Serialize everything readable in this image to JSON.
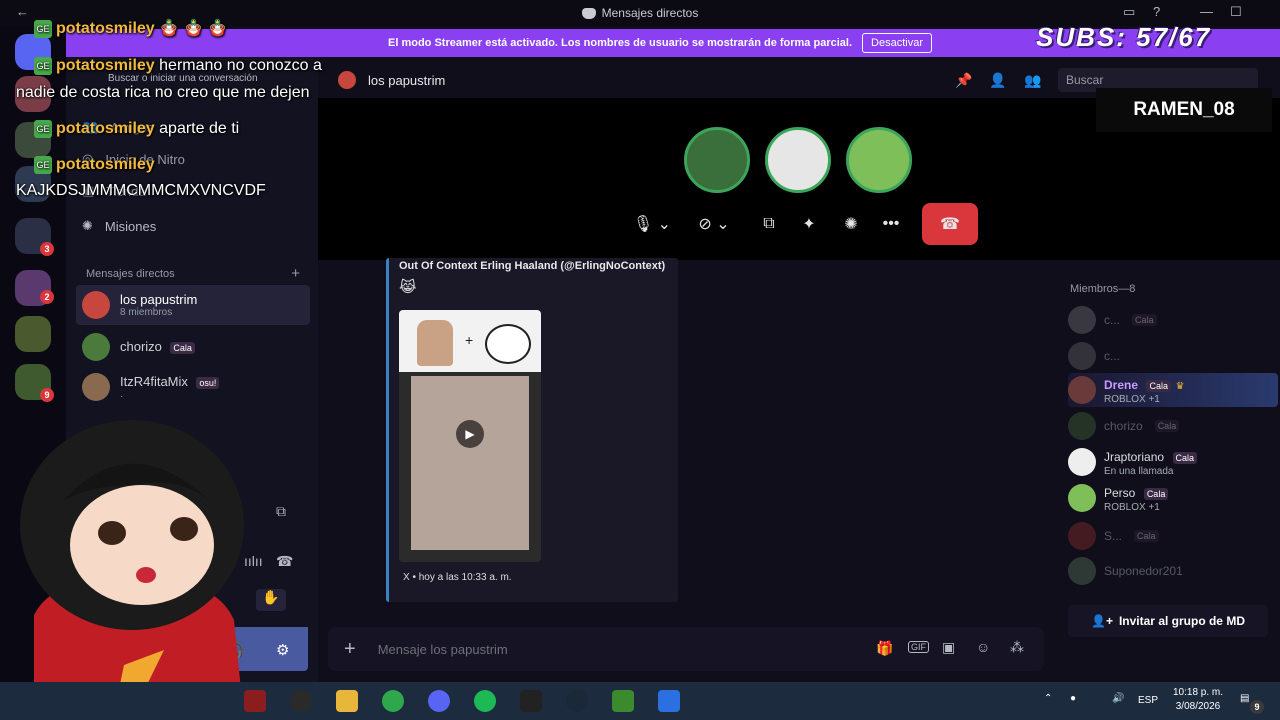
{
  "window": {
    "title": "Mensajes directos"
  },
  "banner": {
    "text": "El modo Streamer está activado. Los nombres de usuario se mostrarán de forma parcial.",
    "button": "Desactivar"
  },
  "overlay": {
    "subs": "SUBS: 57/67",
    "name_card": "RAMEN_08"
  },
  "chat": [
    {
      "user": "potatosmiley",
      "text": "",
      "emotes": [
        "doll-emote",
        "doll-emote",
        "doll-emote"
      ]
    },
    {
      "user": "potatosmiley",
      "text": "hermano no conozco a"
    },
    {
      "user": "",
      "text": "nadie de costa rica no creo que me dejen"
    },
    {
      "user": "potatosmiley",
      "text": "aparte de ti"
    },
    {
      "user": "potatosmiley",
      "text": ""
    },
    {
      "user": "",
      "text": "KAJKDSJMMMCMMCMXVNCVDF"
    }
  ],
  "sidebar": {
    "search_placeholder": "Buscar o iniciar una conversación",
    "friends": "Amigos",
    "nitro": "Inicio de Nitro",
    "shop": "Tienda",
    "missions": "Misiones",
    "dm_header": "Mensajes directos",
    "dms": [
      {
        "name": "los papustrim",
        "sub": "8 miembros"
      },
      {
        "name": "chorizo",
        "tag": "Cala"
      },
      {
        "name": "ItzR4fitaMix",
        "tag": "osu!",
        "sub": "·"
      }
    ]
  },
  "channel": {
    "name": "los papustrim",
    "search": "Buscar"
  },
  "embed": {
    "author": "Out Of Context Erling Haaland (@ErlingNoContext)",
    "emoji": "😹",
    "footer": "X • hoy a las 10:33 a. m."
  },
  "message_bar": {
    "placeholder": "Mensaje los papustrim"
  },
  "members": {
    "header": "Miembros—8",
    "list": [
      {
        "name": "c...",
        "tag": "Cala",
        "dim": true
      },
      {
        "name": "c...",
        "dim": true
      },
      {
        "name": "Drene",
        "tag": "Cala",
        "sub": "ROBLOX +1",
        "dim": false,
        "color": "#c79bff"
      },
      {
        "name": "chorizo",
        "tag": "Cala",
        "dim": true
      },
      {
        "name": "Jraptoriano",
        "tag": "Cala",
        "sub": "En una llamada",
        "dim": false
      },
      {
        "name": "Perso",
        "tag": "Cala",
        "sub": "ROBLOX +1",
        "dim": false
      },
      {
        "name": "S...",
        "tag": "Cala",
        "dim": true
      },
      {
        "name": "Suponedor201",
        "dim": true
      }
    ],
    "invite": "Invitar al grupo de MD"
  },
  "taskbar": {
    "lang": "ESP",
    "time": "10:18 p. m.",
    "date": "3/08/2026",
    "notif": "9"
  },
  "colors": {
    "banner": "#8a3ff0",
    "hangup": "#da373c",
    "accent": "#5865f2"
  }
}
